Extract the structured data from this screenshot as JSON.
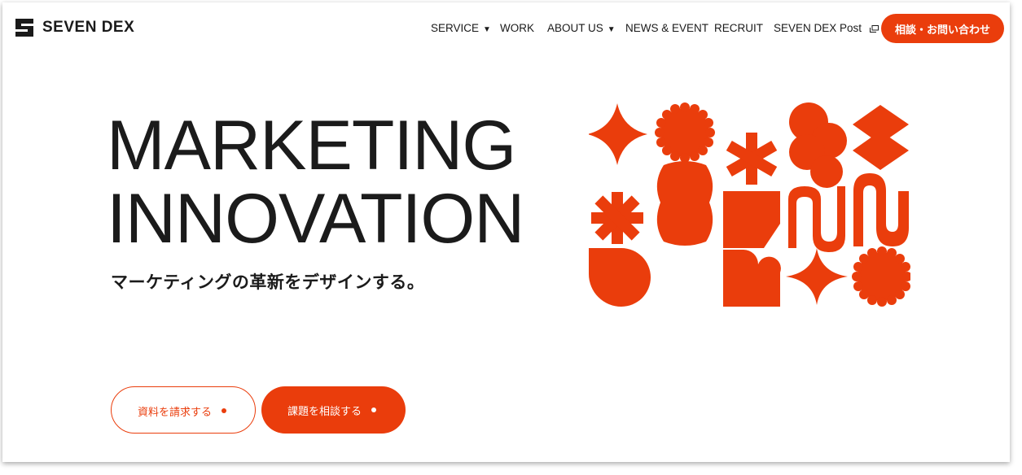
{
  "header": {
    "logo_text": "SEVEN DEX",
    "nav": [
      {
        "label": "SERVICE",
        "has_caret": true
      },
      {
        "label": "WORK",
        "has_caret": false
      },
      {
        "label": "ABOUT US",
        "has_caret": true
      },
      {
        "label": "NEWS & EVENT",
        "has_caret": false
      },
      {
        "label": "RECRUIT",
        "has_caret": false
      },
      {
        "label": "SEVEN DEX Post",
        "has_caret": false,
        "icon": "external-window-icon"
      }
    ],
    "caret_glyph": "▼",
    "contact_button": "相談・お問い合わせ"
  },
  "hero": {
    "title_line1": "MARKETING",
    "title_line2": "INNOVATION",
    "subtitle": "マーケティングの革新をデザインする。"
  },
  "actions": {
    "request_docs": "資料を請求する",
    "consult_issue": "課題を相談する"
  },
  "colors": {
    "accent": "#ea3d0c",
    "text": "#1b1b1b",
    "background": "#ffffff"
  }
}
